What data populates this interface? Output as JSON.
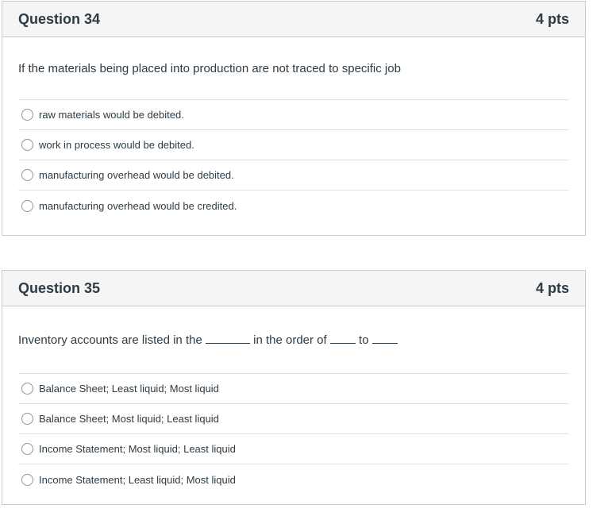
{
  "questions": [
    {
      "title": "Question 34",
      "points": "4 pts",
      "text": "If the materials being placed into production are not traced to specific job",
      "answers": [
        "raw materials would be debited.",
        "work in process would be debited.",
        "manufacturing overhead would be debited.",
        "manufacturing overhead would be credited."
      ]
    },
    {
      "title": "Question 35",
      "points": "4 pts",
      "text_parts": [
        "Inventory accounts are listed in the ",
        " in the order of ",
        " to "
      ],
      "answers": [
        "Balance Sheet; Least liquid; Most liquid",
        "Balance Sheet; Most liquid; Least liquid",
        "Income Statement; Most liquid; Least liquid",
        "Income Statement; Least liquid; Most liquid"
      ]
    }
  ]
}
